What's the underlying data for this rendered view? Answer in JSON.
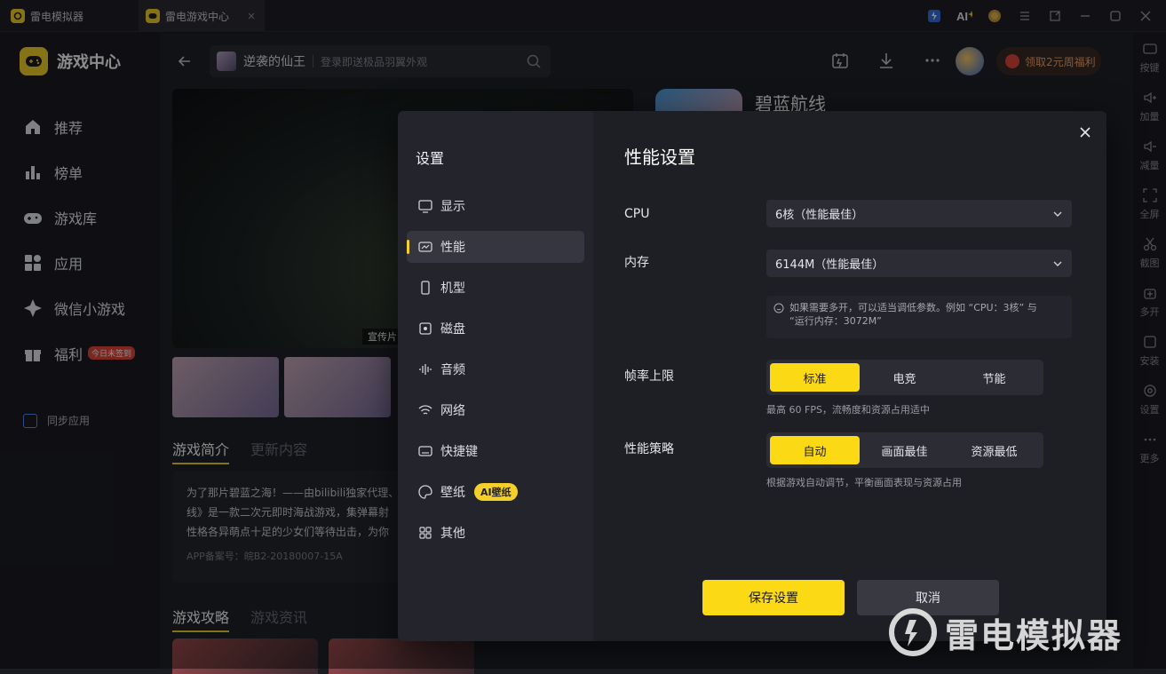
{
  "titlebar": {
    "tab1_label": "雷电模拟器",
    "tab2_label": "雷电游戏中心"
  },
  "leftnav": {
    "brand": "游戏中心",
    "items": [
      {
        "label": "推荐",
        "icon": "home-icon"
      },
      {
        "label": "榜单",
        "icon": "rank-icon"
      },
      {
        "label": "游戏库",
        "icon": "gamepad-icon"
      },
      {
        "label": "应用",
        "icon": "apps-icon"
      },
      {
        "label": "微信小游戏",
        "icon": "wechat-game-icon"
      },
      {
        "label": "福利",
        "icon": "gift-icon",
        "badge": "今日未签到"
      }
    ],
    "sync_label": "同步应用"
  },
  "topbar": {
    "search_game": "逆袭的仙王",
    "search_placeholder": "登录即送极品羽翼外观",
    "welfare_label": "领取2元周福利"
  },
  "content": {
    "hero_tag": "宣传片",
    "game_name": "碧蓝航线",
    "tabs": [
      "游戏简介",
      "更新内容"
    ],
    "description": "为了那片碧蓝之海！——由bilibili独家代理、",
    "description_2": "线》是一款二次元即时海战游戏，集弹幕射",
    "description_3": "性格各异萌点十足的少女们等待出击，为你",
    "app_record": "APP备案号：皖B2-20180007-15A",
    "tabs2": [
      "游戏攻略",
      "游戏资讯"
    ]
  },
  "rightbar": [
    "按键",
    "加量",
    "减量",
    "全屏",
    "截图",
    "多开",
    "安装",
    "设置",
    "更多"
  ],
  "dialog": {
    "title": "设置",
    "menu": [
      {
        "label": "显示",
        "icon": "monitor-icon"
      },
      {
        "label": "性能",
        "icon": "performance-icon"
      },
      {
        "label": "机型",
        "icon": "phone-icon"
      },
      {
        "label": "磁盘",
        "icon": "disk-icon"
      },
      {
        "label": "音频",
        "icon": "audio-icon"
      },
      {
        "label": "网络",
        "icon": "wifi-icon"
      },
      {
        "label": "快捷键",
        "icon": "keyboard-icon"
      },
      {
        "label": "壁纸",
        "icon": "palette-icon",
        "badge": "AI壁纸"
      },
      {
        "label": "其他",
        "icon": "grid-icon"
      }
    ],
    "selected_menu": "性能",
    "section_title": "性能设置",
    "cpu": {
      "label": "CPU",
      "value": "6核（性能最佳）"
    },
    "memory": {
      "label": "内存",
      "value": "6144M（性能最佳）"
    },
    "hint_line1": "如果需要多开，可以适当调低参数。例如 “CPU：3核” 与",
    "hint_line2": "“运行内存：3072M”",
    "fps": {
      "label": "帧率上限",
      "options": [
        "标准",
        "电竞",
        "节能"
      ],
      "selected": "标准",
      "sub": "最高 60 FPS，流畅度和资源占用适中"
    },
    "strategy": {
      "label": "性能策略",
      "options": [
        "自动",
        "画面最佳",
        "资源最低"
      ],
      "selected": "自动",
      "sub": "根据游戏自动调节，平衡画面表现与资源占用"
    },
    "save_label": "保存设置",
    "cancel_label": "取消"
  },
  "watermark": "雷电模拟器",
  "colors": {
    "accent": "#fbd915",
    "bg": "#1e1f25",
    "badge_red": "#e2463b"
  }
}
